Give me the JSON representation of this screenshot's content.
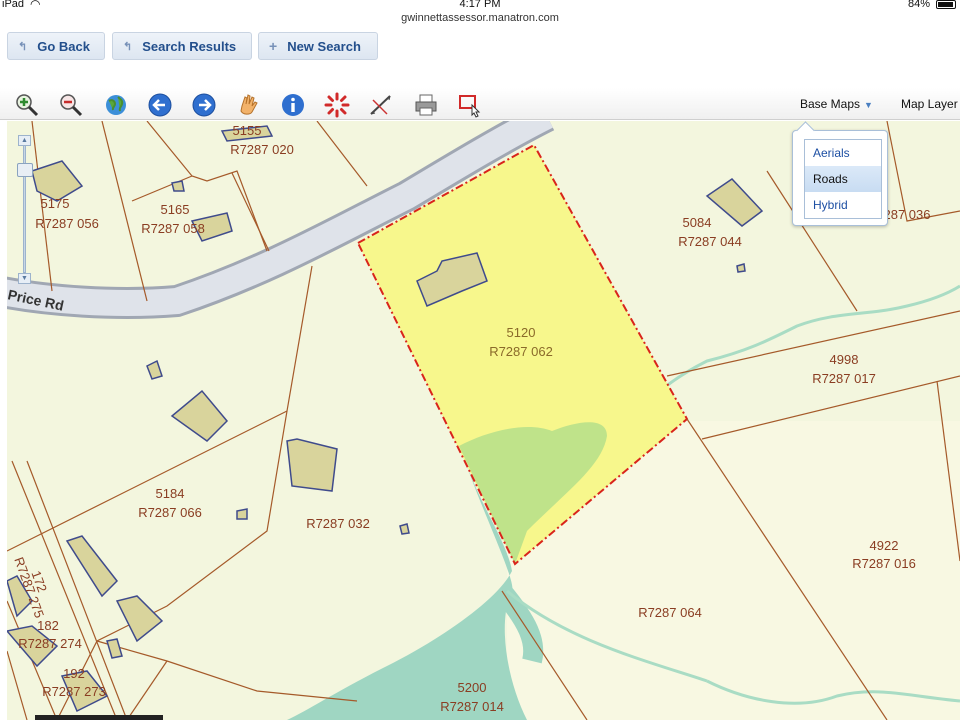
{
  "status_bar": {
    "carrier": "iPad",
    "time": "4:17 PM",
    "battery": "84%"
  },
  "browser": {
    "url": "gwinnettassessor.manatron.com"
  },
  "nav_buttons": [
    {
      "label": "Go Back",
      "icon": "back-arrow-icon"
    },
    {
      "label": "Search Results",
      "icon": "back-arrow-icon"
    },
    {
      "label": "New Search",
      "icon": "plus-icon"
    }
  ],
  "toolbar": {
    "tools": [
      "zoom-in-icon",
      "zoom-out-icon",
      "globe-icon",
      "arrow-left-icon",
      "arrow-right-icon",
      "hand-pan-icon",
      "info-icon",
      "select-burst-icon",
      "measure-icon",
      "print-icon",
      "select-rectangle-icon"
    ],
    "base_maps_label": "Base Maps",
    "map_layers_label": "Map Layer"
  },
  "base_maps_menu": {
    "options": [
      "Aerials",
      "Roads",
      "Hybrid"
    ],
    "selected": "Roads"
  },
  "map": {
    "road_name": "Price Rd",
    "colors": {
      "background": "#f3f6de",
      "selected_parcel": "#f7f78c",
      "water": "#9fd6c2",
      "wooded": "#bfe38a",
      "building": "#d9d49c",
      "parcel_line": "#a55a2a",
      "selection_outline": "#d9241b"
    },
    "parcels": [
      {
        "address": "5155",
        "id": "R7287 020"
      },
      {
        "address": "5175",
        "id": "R7287 056"
      },
      {
        "address": "5165",
        "id": "R7287 058"
      },
      {
        "address": "5084",
        "id": "R7287 044"
      },
      {
        "address": "",
        "id": "287 036"
      },
      {
        "address": "5120",
        "id": "R7287 062",
        "selected": true
      },
      {
        "address": "4998",
        "id": "R7287 017"
      },
      {
        "address": "5184",
        "id": "R7287 066"
      },
      {
        "address": "",
        "id": "R7287 032"
      },
      {
        "address": "4922",
        "id": "R7287 016"
      },
      {
        "address": "",
        "id": "R7287 064"
      },
      {
        "address": "5200",
        "id": "R7287 014"
      },
      {
        "address": "172",
        "id": "R7287 275"
      },
      {
        "address": "182",
        "id": "R7287 274"
      },
      {
        "address": "192",
        "id": "R7287 273"
      }
    ]
  }
}
